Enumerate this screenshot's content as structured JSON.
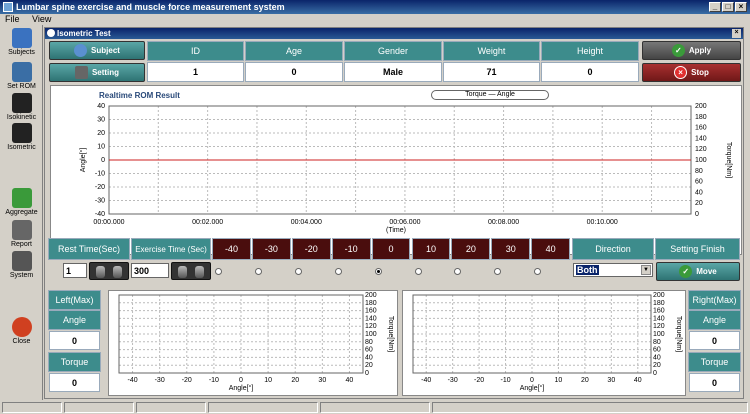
{
  "app": {
    "title": "Lumbar spine exercise and muscle force measurement system"
  },
  "menu": [
    "File",
    "View"
  ],
  "window_buttons": {
    "minimize": "_",
    "maximize": "□",
    "close": "×"
  },
  "toolbar": [
    {
      "label": "Subjects",
      "icon": "subjects-icon",
      "color": "#3a72c0"
    },
    {
      "label": "Set ROM",
      "icon": "set-rom-icon",
      "color": "#3a6ea5"
    },
    {
      "label": "Isokinetic",
      "icon": "isokinetic-icon",
      "color": "#222222"
    },
    {
      "label": "Isometric",
      "icon": "isometric-icon",
      "color": "#222222"
    },
    {
      "label": "Aggregate",
      "icon": "aggregate-icon",
      "color": "#3a9a3a"
    },
    {
      "label": "Report",
      "icon": "report-icon",
      "color": "#666666"
    },
    {
      "label": "System",
      "icon": "system-icon",
      "color": "#555555"
    },
    {
      "label": "Close",
      "icon": "close-icon",
      "color": "#d04020"
    }
  ],
  "inner": {
    "title": "Isometric Test",
    "close": "×"
  },
  "subject": {
    "subject_btn": "Subject",
    "setting_btn": "Setting",
    "headers": [
      "ID",
      "Age",
      "Gender",
      "Weight",
      "Height"
    ],
    "values": [
      "1",
      "0",
      "Male",
      "71",
      "0"
    ],
    "apply_btn": "Apply",
    "stop_btn": "Stop"
  },
  "chart": {
    "title": "Realtime ROM  Result",
    "legend": "Torque — Angle"
  },
  "chart_data": [
    {
      "type": "line",
      "title": "Realtime ROM  Result",
      "xlabel": "(Time)",
      "ylabel": "Angle[°]",
      "y2label": "Torque[Nm]",
      "x_ticks": [
        "00:00.000",
        "00:02.000",
        "00:04.000",
        "00:06.000",
        "00:08.000",
        "00:10.000"
      ],
      "y_ticks": [
        "40",
        "30",
        "20",
        "10",
        "0",
        "-10",
        "-20",
        "-30",
        "-40"
      ],
      "y2_ticks": [
        "200",
        "180",
        "160",
        "140",
        "120",
        "100",
        "80",
        "60",
        "40",
        "20",
        "0"
      ],
      "ylim": [
        -45,
        45
      ],
      "y2lim": [
        0,
        200
      ],
      "series": [
        {
          "name": "Torque",
          "color": "#7a1010",
          "values": [
            0,
            0
          ]
        },
        {
          "name": "Angle",
          "color": "#cc2020",
          "values": [
            0,
            0
          ]
        }
      ],
      "grid": true
    },
    {
      "type": "scatter",
      "xlabel": "Angle[°]",
      "y2label": "Torque[Nm]",
      "x_ticks": [
        "-40",
        "-30",
        "-20",
        "-10",
        "0",
        "10",
        "20",
        "30",
        "40"
      ],
      "y2_ticks": [
        "200",
        "180",
        "160",
        "140",
        "120",
        "100",
        "80",
        "60",
        "40",
        "20",
        "0"
      ],
      "xlim": [
        -45,
        45
      ],
      "ylim": [
        0,
        200
      ],
      "values": [],
      "grid": true
    },
    {
      "type": "scatter",
      "xlabel": "Angle[°]",
      "y2label": "Torque[Nm]",
      "x_ticks": [
        "-40",
        "-30",
        "-20",
        "-10",
        "0",
        "10",
        "20",
        "30",
        "40"
      ],
      "y2_ticks": [
        "200",
        "180",
        "160",
        "140",
        "120",
        "100",
        "80",
        "60",
        "40",
        "20",
        "0"
      ],
      "xlim": [
        -45,
        45
      ],
      "ylim": [
        0,
        200
      ],
      "values": [],
      "grid": true
    }
  ],
  "controls": {
    "rest_time_label": "Rest Time(Sec)",
    "rest_time_value": "1",
    "exercise_time_label": "Exercise Time (Sec)",
    "exercise_time_value": "300",
    "angles": [
      "-40",
      "-30",
      "-20",
      "-10",
      "0",
      "10",
      "20",
      "30",
      "40"
    ],
    "selected_angle": "0",
    "direction_label": "Direction",
    "direction_value": "Both",
    "setting_finish_label": "Setting Finish",
    "move_btn": "Move"
  },
  "left_panel": {
    "title": "Left(Max)",
    "angle_label": "Angle",
    "angle_value": "0",
    "torque_label": "Torque",
    "torque_value": "0"
  },
  "right_panel": {
    "title": "Right(Max)",
    "angle_label": "Angle",
    "angle_value": "0",
    "torque_label": "Torque",
    "torque_value": "0"
  },
  "colors": {
    "teal": "#3d8c8c",
    "maroon": "#4a0d0d",
    "apply_green": "#3a9a3a",
    "stop_red": "#c02020"
  }
}
